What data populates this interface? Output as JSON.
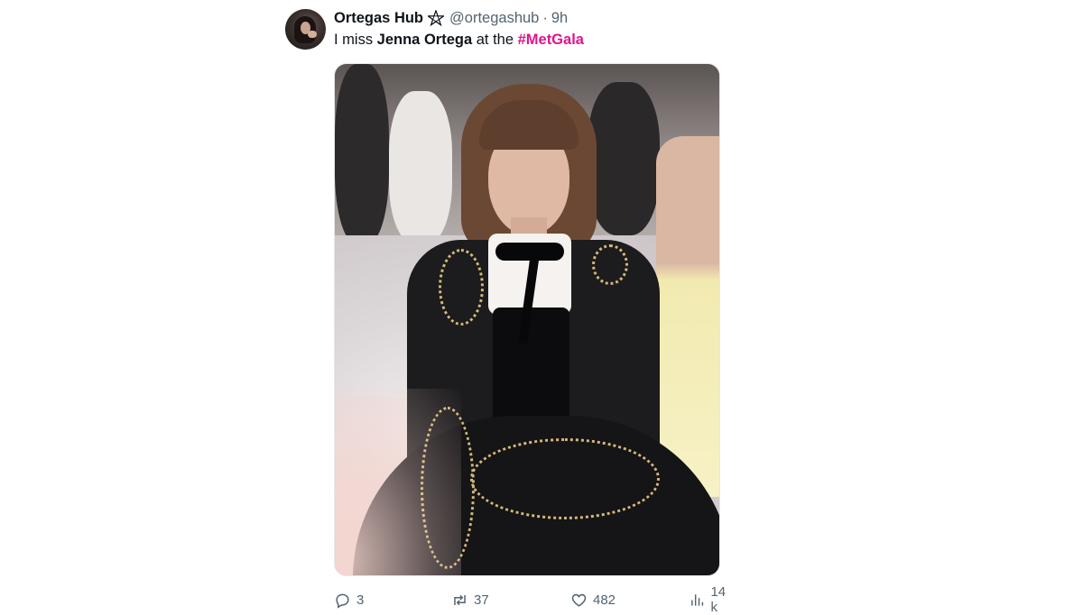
{
  "tweet": {
    "display_name": "Ortegas Hub",
    "badge_icon": "pentagram-icon",
    "handle": "@ortegashub",
    "separator": "·",
    "time": "9h",
    "text_prefix": "I miss ",
    "text_bold": "Jenna Ortega",
    "text_middle": " at the ",
    "hashtag": "#MetGala",
    "hashtag_color": "#e0138d"
  },
  "actions": {
    "replies": "3",
    "retweets": "37",
    "likes": "482",
    "views": "14 k"
  },
  "icons": {
    "reply": "reply-icon",
    "retweet": "retweet-icon",
    "like": "heart-icon",
    "views": "views-chart-icon"
  }
}
